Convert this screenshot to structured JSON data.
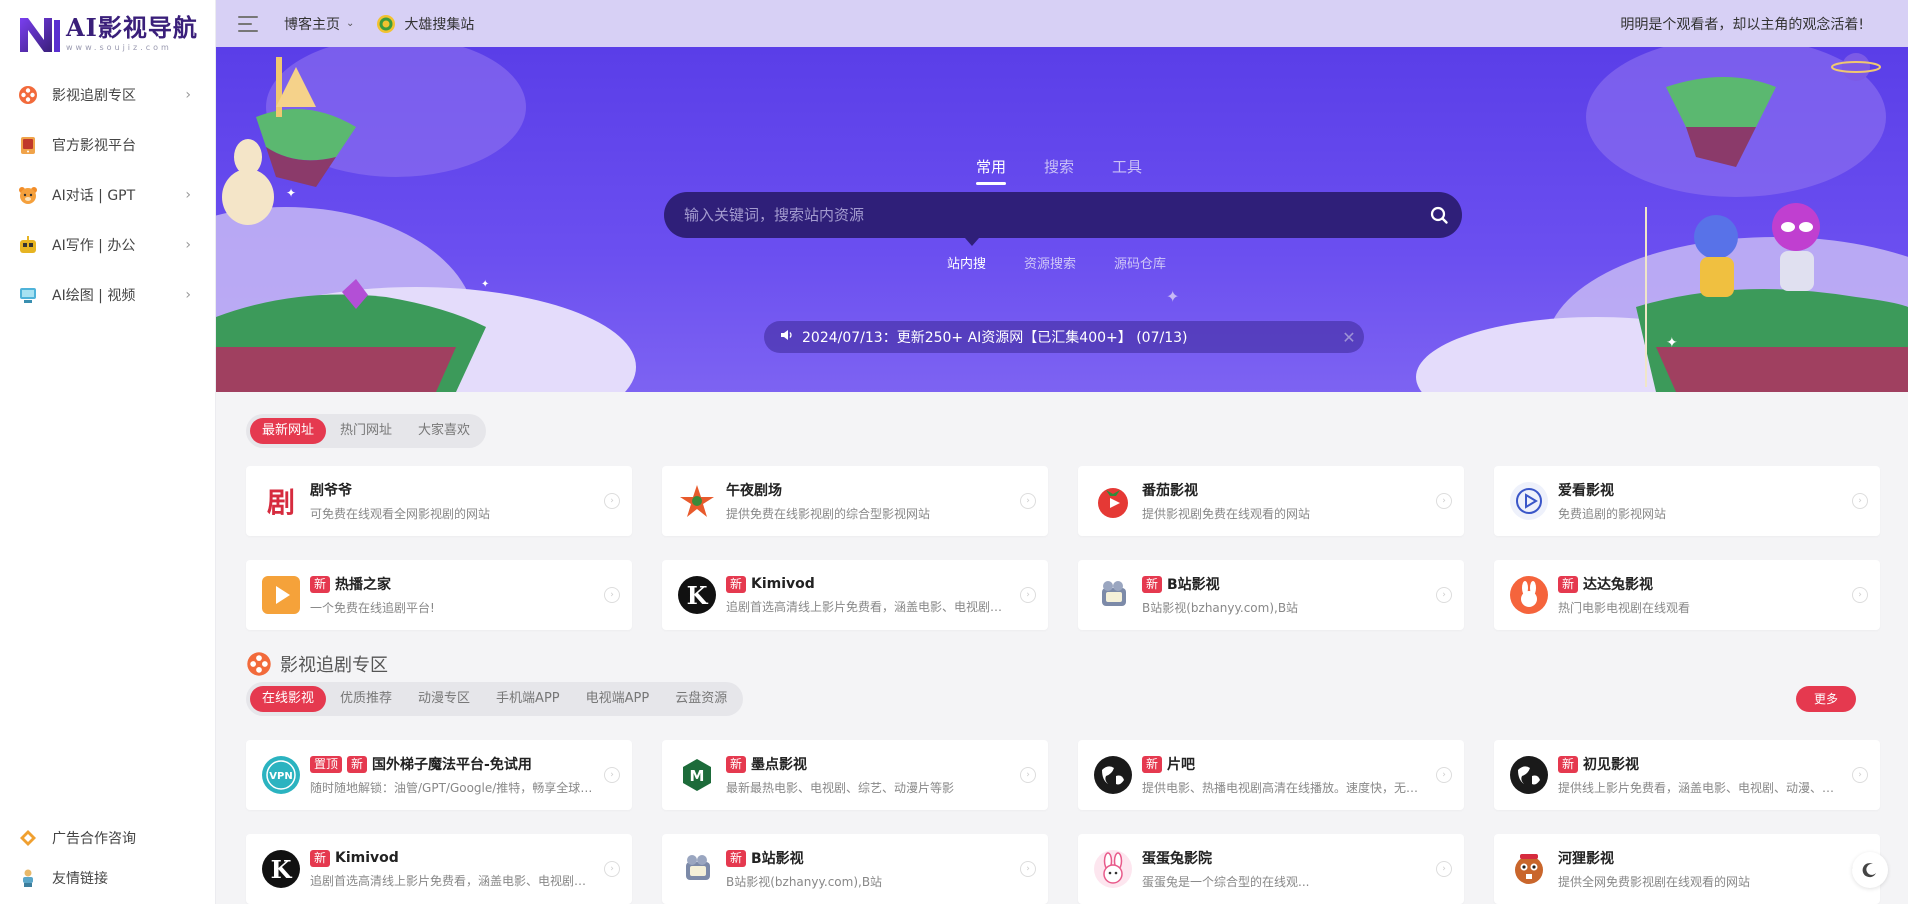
{
  "logo": {
    "title": "AI影视导航",
    "subtitle": "www.soujiz.com"
  },
  "sidebar": {
    "items": [
      {
        "label": "影视追剧专区",
        "icon": "film-reel-icon",
        "has_children": true
      },
      {
        "label": "官方影视平台",
        "icon": "tv-icon",
        "has_children": false
      },
      {
        "label": "AI对话 | GPT",
        "icon": "bear-icon",
        "has_children": true
      },
      {
        "label": "AI写作 | 办公",
        "icon": "robot-icon",
        "has_children": true
      },
      {
        "label": "AI绘图 | 视频",
        "icon": "monitor-icon",
        "has_children": true
      }
    ],
    "bottom": [
      {
        "label": "广告合作咨询",
        "icon": "megaphone-icon"
      },
      {
        "label": "友情链接",
        "icon": "person-icon"
      }
    ]
  },
  "topbar": {
    "home_label": "博客主页",
    "collect_label": "大雄搜集站",
    "slogan": "明明是个观看者，却以主角的观念活着!"
  },
  "hero": {
    "tabs": [
      "常用",
      "搜索",
      "工具"
    ],
    "active_tab": 0,
    "search_placeholder": "输入关键词，搜索站内资源",
    "subtabs": [
      "站内搜",
      "资源搜索",
      "源码仓库"
    ],
    "active_subtab": 0,
    "notice": "2024/07/13：更新250+ AI资源网【已汇集400+】 (07/13)"
  },
  "latest": {
    "tabs": [
      "最新网址",
      "热门网址",
      "大家喜欢"
    ],
    "cards": [
      {
        "title": "剧爷爷",
        "desc": "可免费在线观看全网影视剧的网站",
        "badges": [],
        "icon": "ju-logo-icon"
      },
      {
        "title": "午夜剧场",
        "desc": "提供免费在线影视剧的综合型影视网站",
        "badges": [],
        "icon": "star-logo-icon"
      },
      {
        "title": "番茄影视",
        "desc": "提供影视剧免费在线观看的网站",
        "badges": [],
        "icon": "tomato-icon"
      },
      {
        "title": "爱看影视",
        "desc": "免费追剧的影视网站",
        "badges": [],
        "icon": "play-circle-icon"
      },
      {
        "title": "热播之家",
        "desc": "一个免费在线追剧平台!",
        "badges": [
          "新"
        ],
        "icon": "orange-play-icon"
      },
      {
        "title": "Kimivod",
        "desc": "追剧首选高清线上影片免费看，涵盖电影、电视剧、动...",
        "badges": [
          "新"
        ],
        "icon": "k-logo-icon"
      },
      {
        "title": "B站影视",
        "desc": "B站影视(bzhanyy.com),B站",
        "badges": [
          "新"
        ],
        "icon": "camera-robot-icon"
      },
      {
        "title": "达达兔影视",
        "desc": "热门电影电视剧在线观看",
        "badges": [
          "新"
        ],
        "icon": "rabbit-icon"
      }
    ]
  },
  "section": {
    "title": "影视追剧专区",
    "tabs": [
      "在线影视",
      "优质推荐",
      "动漫专区",
      "手机端APP",
      "电视端APP",
      "云盘资源"
    ],
    "more_label": "更多",
    "cards": [
      {
        "title": "国外梯子魔法平台-免试用",
        "desc": "随时随地解锁：油管/GPT/Google/推特，畅享全球自...",
        "badges": [
          "置顶",
          "新"
        ],
        "icon": "vpn-icon"
      },
      {
        "title": "墨点影视",
        "desc": "最新最热电影、电视剧、综艺、动漫片等影",
        "badges": [
          "新"
        ],
        "icon": "m-hex-icon"
      },
      {
        "title": "片吧",
        "desc": "提供电影、热播电视剧高清在线播放。速度快，无广告...",
        "badges": [
          "新"
        ],
        "icon": "globe-icon"
      },
      {
        "title": "初见影视",
        "desc": "提供线上影片免费看，涵盖电影、电视剧、动漫、综艺...",
        "badges": [
          "新"
        ],
        "icon": "globe-icon"
      },
      {
        "title": "Kimivod",
        "desc": "追剧首选高清线上影片免费看，涵盖电影、电视剧、动...",
        "badges": [
          "新"
        ],
        "icon": "k-logo-icon"
      },
      {
        "title": "B站影视",
        "desc": "B站影视(bzhanyy.com),B站",
        "badges": [
          "新"
        ],
        "icon": "camera-robot-icon"
      },
      {
        "title": "蛋蛋兔影院",
        "desc": "蛋蛋兔是一个综合型的在线观...",
        "badges": [],
        "icon": "bunny-icon"
      },
      {
        "title": "河狸影视",
        "desc": "提供全网免费影视剧在线观看的网站",
        "badges": [],
        "icon": "beaver-icon"
      }
    ]
  },
  "colors": {
    "accent": "#e5394f",
    "hero": "#6b4ff0",
    "search_box": "#2f1f79",
    "topbar": "#d7d0f5"
  }
}
